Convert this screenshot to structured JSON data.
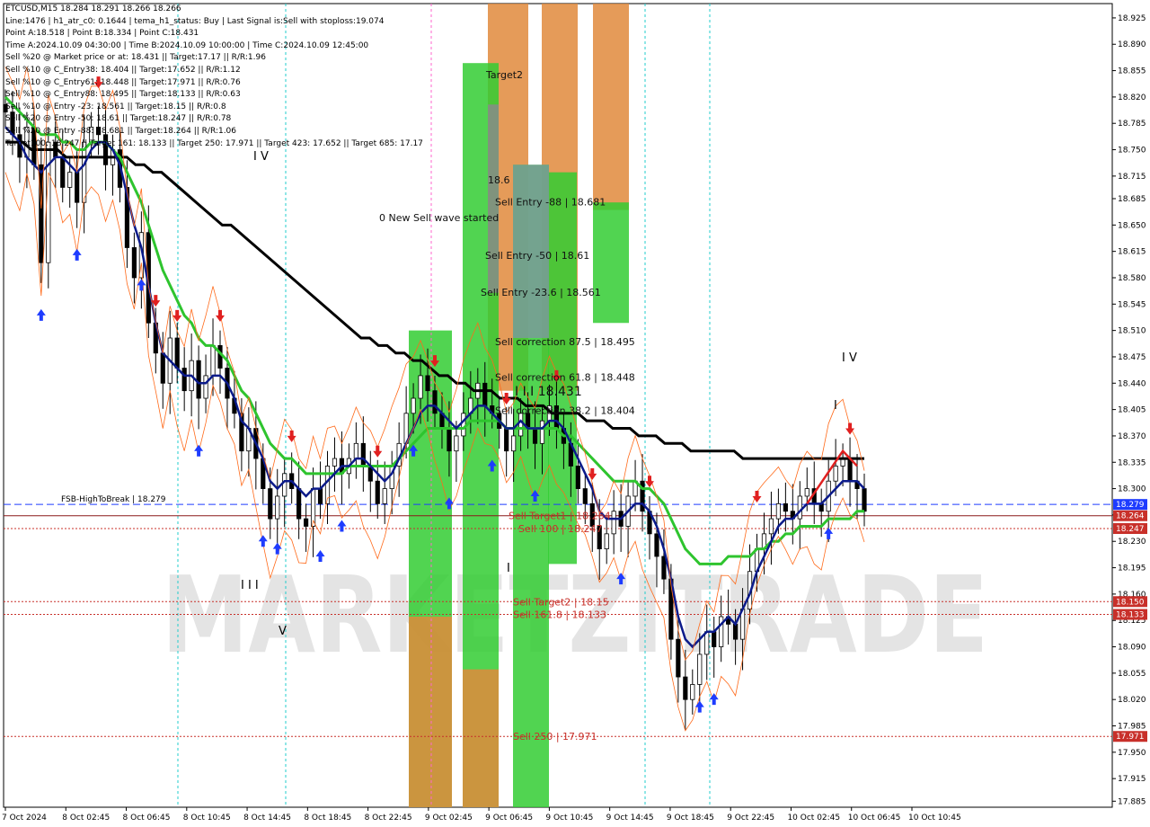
{
  "chart_data": {
    "type": "candlestick",
    "symbol_title": "ETCUSD,M15  18.284 18.291 18.266 18.266",
    "info_lines": [
      "Line:1476  |  h1_atr_c0: 0.1644  |  tema_h1_status: Buy  |  Last Signal is:Sell with stoploss:19.074",
      "Point A:18.518  |  Point B:18.334  |  Point C:18.431",
      "Time A:2024.10.09 04:30:00  |  Time B:2024.10.09 10:00:00  |  Time C:2024.10.09 12:45:00",
      "Sell %20 @ Market price or at: 18.431  ||  Target:17.17  ||  R/R:1.96",
      "Sell %10 @ C_Entry38: 18.404  ||  Target:17.652  ||  R/R:1.12",
      "Sell %10 @ C_Entry61: 18.448  ||  Target:17.971  ||  R/R:0.76",
      "Sell %10 @ C_Entry88: 18.495  ||  Target:18.133  ||  R/R:0.63",
      "Sell %10 @ Entry -23: 18.561  ||  Target:18.15  ||  R/R:0.8",
      "Sell %20 @ Entry -50: 18.61  ||  Target:18.247  ||  R/R:0.78",
      "Sell %20 @ Entry -88: 18.681  ||  Target:18.264  ||  R/R:1.06",
      "Target100: 18.247  ||  Target 161: 18.133  ||  Target 250: 17.971  ||  Target 423: 17.652  ||  Target 685: 17.17"
    ],
    "y_ticks": [
      "18.925",
      "18.890",
      "18.855",
      "18.820",
      "18.785",
      "18.750",
      "18.715",
      "18.685",
      "18.650",
      "18.615",
      "18.580",
      "18.545",
      "18.510",
      "18.475",
      "18.440",
      "18.405",
      "18.370",
      "18.335",
      "18.300",
      "18.265",
      "18.230",
      "18.195",
      "18.160",
      "18.125",
      "18.090",
      "18.055",
      "18.020",
      "17.985",
      "17.950",
      "17.915",
      "17.885"
    ],
    "ylim": [
      17.877,
      18.944
    ],
    "x_ticks": [
      "7 Oct 2024",
      "8 Oct 02:45",
      "8 Oct 06:45",
      "8 Oct 10:45",
      "8 Oct 14:45",
      "8 Oct 18:45",
      "8 Oct 22:45",
      "9 Oct 02:45",
      "9 Oct 06:45",
      "9 Oct 10:45",
      "9 Oct 14:45",
      "9 Oct 18:45",
      "9 Oct 22:45",
      "10 Oct 02:45",
      "10 Oct 06:45",
      "10 Oct 10:45"
    ],
    "price_labels": [
      {
        "text": "18.279",
        "value": 18.279,
        "color": "#1e3cff"
      },
      {
        "text": "18.264",
        "value": 18.264,
        "color": "#c8302a"
      },
      {
        "text": "18.247",
        "value": 18.247,
        "color": "#c8302a"
      },
      {
        "text": "18.150",
        "value": 18.15,
        "color": "#c8302a"
      },
      {
        "text": "18.133",
        "value": 18.133,
        "color": "#c8302a"
      },
      {
        "text": "17.971",
        "value": 17.971,
        "color": "#c8302a"
      }
    ],
    "levels": [
      {
        "label": "FSB-HighToBreak  |  18.279",
        "value": 18.279,
        "color": "#1e3cff",
        "style": "dashed"
      },
      {
        "value": 18.264,
        "color": "#8b1a1a",
        "style": "solid"
      },
      {
        "value": 18.247,
        "color": "#c8302a",
        "style": "dotted"
      },
      {
        "value": 18.15,
        "color": "#c8302a",
        "style": "dotted"
      },
      {
        "value": 18.133,
        "color": "#c8302a",
        "style": "dotted"
      },
      {
        "value": 17.971,
        "color": "#c8302a",
        "style": "dotted"
      }
    ],
    "annotations": [
      {
        "text": "Sell Entry -88 | 18.681",
        "value": 18.681
      },
      {
        "text": "Sell Entry -50 | 18.61",
        "value": 18.61
      },
      {
        "text": "I I I 18.431",
        "value": 18.431
      },
      {
        "text": "Sell Entry -23.6 | 18.561",
        "value": 18.561
      },
      {
        "text": "Sell correction 87.5 | 18.495",
        "value": 18.495
      },
      {
        "text": "Sell correction 61.8 | 18.448",
        "value": 18.448
      },
      {
        "text": "Sell correction 38.2 | 18.404",
        "value": 18.404
      },
      {
        "text": "Sell Target1 | 18.264",
        "value": 18.264
      },
      {
        "text": "Sell 100 | 18.247",
        "value": 18.247
      },
      {
        "text": "Sell Target2 | 18.15",
        "value": 18.15
      },
      {
        "text": "Sell 161.8 | 18.133",
        "value": 18.133
      },
      {
        "text": "Sell  250 | 17.971",
        "value": 17.971
      },
      {
        "text": "0 New Sell wave started",
        "value": 18.66
      },
      {
        "text": "Target2",
        "value": 18.85
      },
      {
        "text": "18.6",
        "value": 18.71
      }
    ],
    "wave_labels": [
      "I V",
      "I I I",
      "V",
      "I V",
      "I",
      "I"
    ],
    "watermark": "MARKETZITRADE",
    "series": [
      {
        "name": "close",
        "values": [
          18.8,
          18.77,
          18.74,
          18.78,
          18.73,
          18.6,
          18.76,
          18.74,
          18.7,
          18.72,
          18.68,
          18.76,
          18.78,
          18.77,
          18.73,
          18.75,
          18.7,
          18.62,
          18.58,
          18.64,
          18.52,
          18.48,
          18.44,
          18.5,
          18.46,
          18.43,
          18.47,
          18.42,
          18.45,
          18.49,
          18.46,
          18.42,
          18.4,
          18.35,
          18.38,
          18.34,
          18.3,
          18.26,
          18.29,
          18.32,
          18.3,
          18.26,
          18.25,
          18.3,
          18.28,
          18.33,
          18.34,
          18.32,
          18.34,
          18.36,
          18.33,
          18.31,
          18.28,
          18.3,
          18.33,
          18.36,
          18.4,
          18.42,
          18.45,
          18.43,
          18.4,
          18.38,
          18.35,
          18.37,
          18.4,
          18.42,
          18.44,
          18.41,
          18.4,
          18.38,
          18.35,
          18.37,
          18.4,
          18.38,
          18.36,
          18.39,
          18.41,
          18.38,
          18.36,
          18.33,
          18.3,
          18.28,
          18.25,
          18.22,
          18.24,
          18.27,
          18.25,
          18.29,
          18.31,
          18.27,
          18.24,
          18.21,
          18.18,
          18.1,
          18.05,
          18.02,
          18.04,
          18.08,
          18.11,
          18.09,
          18.13,
          18.12,
          18.1,
          18.14,
          18.19,
          18.22,
          18.24,
          18.26,
          18.28,
          18.27,
          18.26,
          18.29,
          18.3,
          18.28,
          18.27,
          18.31,
          18.33,
          18.34,
          18.31,
          18.3,
          18.27
        ]
      },
      {
        "name": "tema",
        "values": [
          18.78,
          18.77,
          18.76,
          18.74,
          18.73,
          18.72,
          18.73,
          18.74,
          18.74,
          18.73,
          18.72,
          18.73,
          18.75,
          18.76,
          18.76,
          18.75,
          18.73,
          18.69,
          18.65,
          18.62,
          18.57,
          18.52,
          18.48,
          18.47,
          18.46,
          18.45,
          18.45,
          18.44,
          18.44,
          18.45,
          18.45,
          18.44,
          18.42,
          18.39,
          18.38,
          18.36,
          18.34,
          18.31,
          18.3,
          18.31,
          18.31,
          18.3,
          18.29,
          18.3,
          18.3,
          18.31,
          18.32,
          18.33,
          18.33,
          18.34,
          18.34,
          18.33,
          18.32,
          18.31,
          18.32,
          18.34,
          18.36,
          18.38,
          18.4,
          18.41,
          18.41,
          18.4,
          18.39,
          18.38,
          18.39,
          18.4,
          18.41,
          18.41,
          18.4,
          18.39,
          18.38,
          18.38,
          18.39,
          18.38,
          18.38,
          18.38,
          18.39,
          18.39,
          18.38,
          18.36,
          18.34,
          18.32,
          18.3,
          18.27,
          18.26,
          18.26,
          18.26,
          18.27,
          18.28,
          18.28,
          18.27,
          18.25,
          18.22,
          18.18,
          18.13,
          18.1,
          18.09,
          18.1,
          18.11,
          18.11,
          18.12,
          18.13,
          18.12,
          18.14,
          18.16,
          18.19,
          18.21,
          18.23,
          18.25,
          18.26,
          18.26,
          18.27,
          18.28,
          18.28,
          18.28,
          18.29,
          18.3,
          18.31,
          18.31,
          18.31,
          18.3
        ]
      },
      {
        "name": "ma_green",
        "values": [
          18.82,
          18.81,
          18.8,
          18.79,
          18.78,
          18.77,
          18.77,
          18.77,
          18.76,
          18.76,
          18.75,
          18.75,
          18.76,
          18.76,
          18.76,
          18.75,
          18.74,
          18.72,
          18.7,
          18.68,
          18.65,
          18.62,
          18.59,
          18.57,
          18.55,
          18.53,
          18.52,
          18.5,
          18.49,
          18.49,
          18.48,
          18.47,
          18.45,
          18.43,
          18.42,
          18.4,
          18.38,
          18.36,
          18.35,
          18.34,
          18.34,
          18.33,
          18.32,
          18.32,
          18.32,
          18.32,
          18.32,
          18.32,
          18.33,
          18.33,
          18.33,
          18.33,
          18.33,
          18.33,
          18.33,
          18.34,
          18.35,
          18.36,
          18.37,
          18.38,
          18.38,
          18.38,
          18.38,
          18.38,
          18.38,
          18.39,
          18.39,
          18.39,
          18.39,
          18.39,
          18.38,
          18.38,
          18.38,
          18.38,
          18.38,
          18.38,
          18.38,
          18.38,
          18.37,
          18.37,
          18.36,
          18.35,
          18.34,
          18.33,
          18.32,
          18.31,
          18.31,
          18.31,
          18.31,
          18.3,
          18.3,
          18.29,
          18.28,
          18.26,
          18.24,
          18.22,
          18.21,
          18.2,
          18.2,
          18.2,
          18.2,
          18.21,
          18.21,
          18.21,
          18.21,
          18.22,
          18.22,
          18.23,
          18.23,
          18.24,
          18.24,
          18.25,
          18.25,
          18.25,
          18.25,
          18.26,
          18.26,
          18.26,
          18.26,
          18.27,
          18.27
        ]
      },
      {
        "name": "ma_black",
        "values": [
          18.76,
          18.76,
          18.76,
          18.75,
          18.75,
          18.75,
          18.75,
          18.74,
          18.74,
          18.74,
          18.74,
          18.74,
          18.74,
          18.74,
          18.74,
          18.73,
          18.73,
          18.72,
          18.72,
          18.71,
          18.7,
          18.69,
          18.68,
          18.67,
          18.66,
          18.65,
          18.65,
          18.64,
          18.63,
          18.62,
          18.61,
          18.6,
          18.59,
          18.58,
          18.57,
          18.56,
          18.55,
          18.54,
          18.53,
          18.52,
          18.51,
          18.5,
          18.5,
          18.49,
          18.49,
          18.48,
          18.48,
          18.47,
          18.47,
          18.46,
          18.45,
          18.45,
          18.44,
          18.44,
          18.43,
          18.43,
          18.43,
          18.42,
          18.42,
          18.42,
          18.41,
          18.41,
          18.41,
          18.4,
          18.4,
          18.4,
          18.4,
          18.39,
          18.39,
          18.39,
          18.38,
          18.38,
          18.38,
          18.37,
          18.37,
          18.37,
          18.36,
          18.36,
          18.36,
          18.35,
          18.35,
          18.35,
          18.35,
          18.35,
          18.35,
          18.34,
          18.34,
          18.34,
          18.34,
          18.34,
          18.34,
          18.34,
          18.34,
          18.34,
          18.34,
          18.34,
          18.34,
          18.34,
          18.34,
          18.34
        ]
      }
    ],
    "colors": {
      "tema": "#0b1a8a",
      "ma_green": "#2ec42e",
      "ma_black": "#000000",
      "bull_zone": "#33cc33",
      "bear_zone": "#e08a3c",
      "bull_arrow": "#1e3cff",
      "bear_arrow": "#e02020"
    }
  }
}
